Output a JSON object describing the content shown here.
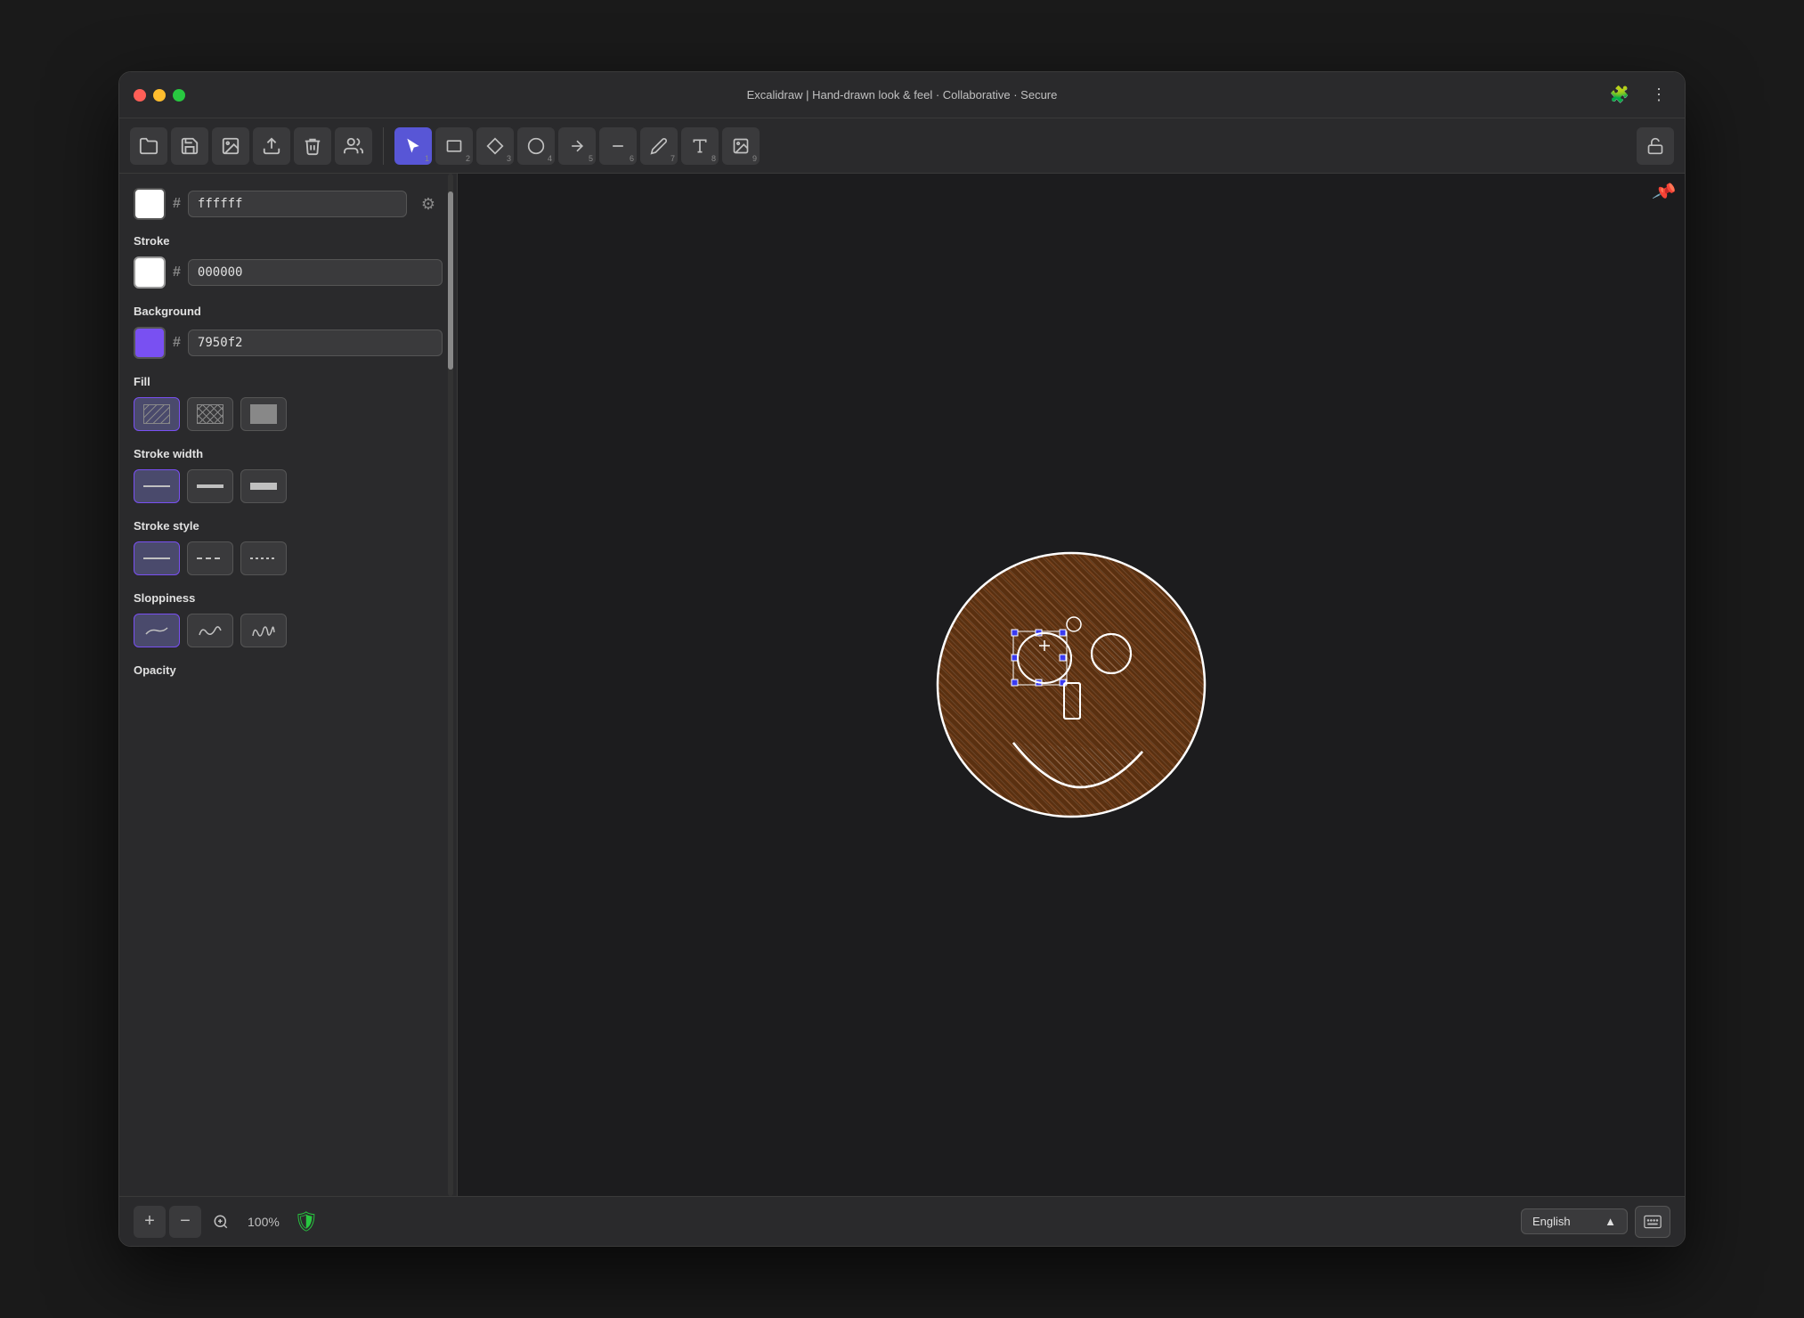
{
  "window": {
    "title": "Excalidraw | Hand-drawn look & feel · Collaborative · Secure"
  },
  "titlebar": {
    "traffic_lights": [
      "red",
      "yellow",
      "green"
    ],
    "right_icons": [
      "puzzle",
      "more"
    ]
  },
  "toolbar": {
    "left_tools": [
      {
        "name": "open",
        "icon": "📂",
        "num": ""
      },
      {
        "name": "save",
        "icon": "💾",
        "num": ""
      },
      {
        "name": "export-image",
        "icon": "🖼",
        "num": ""
      },
      {
        "name": "export-file",
        "icon": "📤",
        "num": ""
      },
      {
        "name": "delete",
        "icon": "🗑",
        "num": ""
      },
      {
        "name": "collab",
        "icon": "👥",
        "num": ""
      }
    ],
    "tools": [
      {
        "name": "select",
        "num": "1"
      },
      {
        "name": "rectangle",
        "num": "2"
      },
      {
        "name": "diamond",
        "num": "3"
      },
      {
        "name": "ellipse",
        "num": "4"
      },
      {
        "name": "arrow",
        "num": "5"
      },
      {
        "name": "line",
        "num": "6"
      },
      {
        "name": "pencil",
        "num": "7"
      },
      {
        "name": "text",
        "num": "8"
      },
      {
        "name": "image",
        "num": "9"
      }
    ],
    "lock_icon": "🔓"
  },
  "sidebar": {
    "canvas_color": "ffffff",
    "stroke": {
      "label": "Stroke",
      "color": "000000"
    },
    "background": {
      "label": "Background",
      "color": "7950f2",
      "swatch_color": "#7950f2"
    },
    "fill": {
      "label": "Fill",
      "options": [
        "hatch",
        "cross-hatch",
        "solid"
      ]
    },
    "stroke_width": {
      "label": "Stroke width",
      "options": [
        "thin",
        "medium",
        "thick"
      ]
    },
    "stroke_style": {
      "label": "Stroke style",
      "options": [
        "solid",
        "dashed",
        "dotted"
      ]
    },
    "sloppiness": {
      "label": "Sloppiness",
      "options": [
        "level1",
        "level2",
        "level3"
      ]
    },
    "opacity": {
      "label": "Opacity"
    }
  },
  "bottom_bar": {
    "zoom_in": "+",
    "zoom_out": "−",
    "zoom_level": "100%",
    "language": "English",
    "shield_color": "#28c840"
  }
}
